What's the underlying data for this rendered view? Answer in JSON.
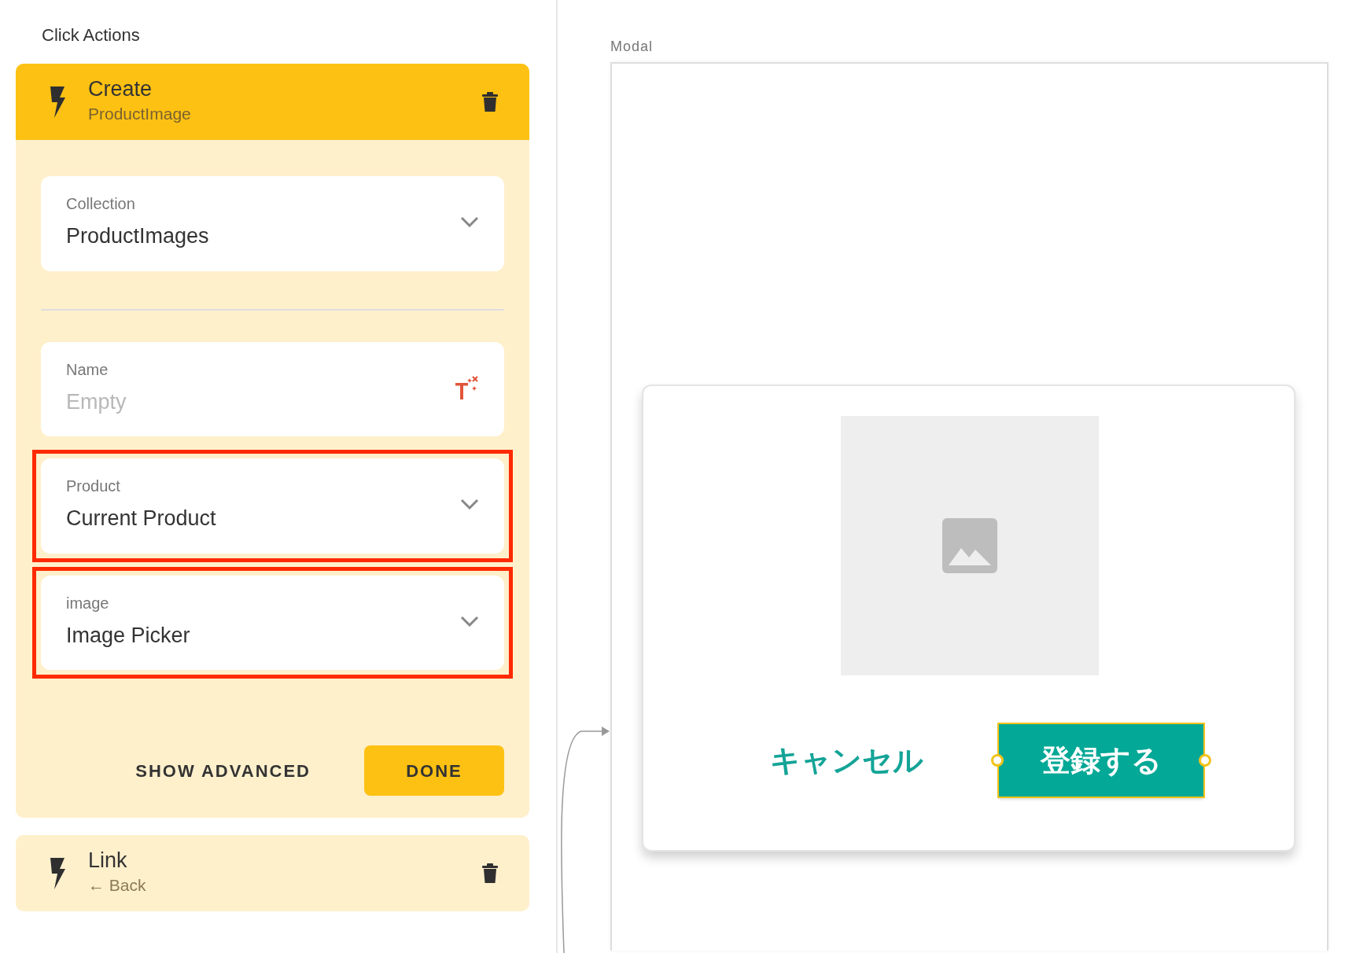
{
  "panel_title": "Click Actions",
  "actions": [
    {
      "title": "Create",
      "subtitle": "ProductImage",
      "expanded": true,
      "fields": [
        {
          "kind": "select",
          "label": "Collection",
          "value": "ProductImages",
          "highlighted": false
        },
        {
          "kind": "divider"
        },
        {
          "kind": "text",
          "label": "Name",
          "placeholder": "Empty",
          "highlighted": false
        },
        {
          "kind": "select",
          "label": "Product",
          "value": "Current Product",
          "highlighted": true
        },
        {
          "kind": "select",
          "label": "image",
          "value": "Image Picker",
          "highlighted": true
        }
      ],
      "buttons": [
        {
          "label": "SHOW ADVANCED",
          "kind": "text"
        },
        {
          "label": "DONE",
          "kind": "primary"
        }
      ]
    },
    {
      "title": "Link",
      "subtitle": "← Back",
      "expanded": false
    }
  ],
  "canvas": {
    "screen_label": "Modal",
    "modal": {
      "image": {
        "kind": "placeholder"
      },
      "buttons": [
        {
          "label": "キャンセル",
          "kind": "text",
          "selected": false
        },
        {
          "label": "登録する",
          "kind": "filled",
          "selected": true
        }
      ]
    }
  }
}
